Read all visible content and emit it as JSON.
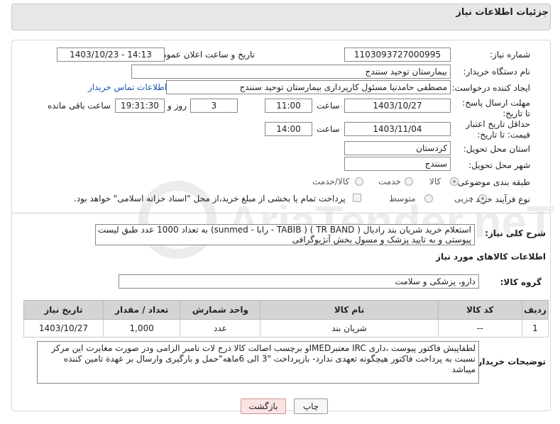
{
  "header": {
    "title": "جزئیات اطلاعات نیاز"
  },
  "need": {
    "number_label": "شماره نیاز:",
    "number": "1103093727000995",
    "announce_label": "تاریخ و ساعت اعلان عمومی:",
    "announce_value": "1403/10/23 - 14:13",
    "buyer_label": "نام دستگاه خریدار:",
    "buyer": "بیمارستان توحید سنندج",
    "creator_label": "ایجاد کننده درخواست:",
    "creator": "مصطفی حامدنیا مسئول کارپردازی بیمارستان توحید سنندج",
    "contact_link": "اطلاعات تماس خریدار",
    "reply_label": "مهلت ارسال پاسخ: تا تاریخ:",
    "reply_date": "1403/10/27",
    "time_word": "ساعت",
    "reply_time": "11:00",
    "days": "3",
    "days_word": "روز و",
    "remaining": "19:31:30",
    "remaining_word": "ساعت باقی مانده",
    "validity_label": "حداقل تاریخ اعتبار قیمت: تا تاریخ:",
    "validity_date": "1403/11/04",
    "validity_time": "14:00",
    "province_label": "استان محل تحویل:",
    "province": "کردستان",
    "city_label": "شهر محل تحویل:",
    "city": "سنندج",
    "category_label": "طبقه بندی موضوعی:",
    "category_options": [
      "کالا",
      "خدمت",
      "کالا/خدمت"
    ],
    "process_label": "نوع فرآیند خرید :",
    "process_options": [
      "جزیی",
      "متوسط"
    ],
    "process_note": "پرداخت تمام یا بخشی از مبلغ خرید،از محل \"اسناد خزانه اسلامی\" خواهد بود."
  },
  "summary": {
    "label": "شرح کلی نیاز:",
    "line1": "استعلام خرید شریان بند رادیال ( TR BAND )  ( TABIB - رابا  - sunmed) به تعداد 1000 عدد طبق لیست",
    "line2": "پیوستی و به تایید  پزشک و مسول بخش آنژیوگرافی"
  },
  "goods": {
    "section_title": "اطلاعات کالاهای مورد نیاز",
    "group_label": "گروه کالا:",
    "group_value": "دارو، پزشکی و سلامت",
    "columns": [
      "ردیف",
      "کد کالا",
      "نام کالا",
      "واحد شمارش",
      "تعداد / مقدار",
      "تاریخ نیاز"
    ],
    "rows": [
      [
        "1",
        "--",
        "شریان بند",
        "عدد",
        "1,000",
        "1403/10/27"
      ]
    ]
  },
  "buyer_notes": {
    "label": "توضیحات خریدار:",
    "text": "لطفاپیش فاکتور پیوست ،داری IRC معتبرIMEDو برچسب اصالت کالا درج لات نامبر الزامی ودر صورت مغایرت این مرکز نسبت به پرداخت فاکتور هیچگونه تعهدی ندارد- بازپرداخت \"3 الی 6ماهه\"حمل و بارگیری وارسال بر عهدة تامین کننده میباشد"
  },
  "buttons": {
    "print": "چاپ",
    "back": "بازگشت"
  },
  "watermark": {
    "text": "AriaTender.neT"
  }
}
